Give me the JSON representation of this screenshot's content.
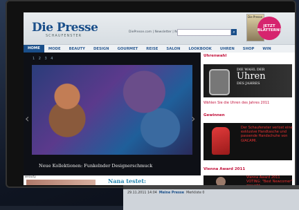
{
  "header": {
    "logo": "Die Presse",
    "tagline": "SCHAUFENSTER",
    "links": "DiePresse.com | Newsletter | Newsfeed",
    "promo_label": "Die Presse",
    "badge_text": "JETZT BLÄTTERN!"
  },
  "nav": {
    "items": [
      "HOME",
      "MODE",
      "BEAUTY",
      "DESIGN",
      "GOURMET",
      "REISE",
      "SALON",
      "LOOKBOOK",
      "UHREN",
      "SHOP",
      "WIN"
    ]
  },
  "hero": {
    "pager": "1 2 3 4",
    "caption": "Neue Kollektionen: Funkelnder Designerschmuck"
  },
  "sidebar": {
    "section1_title": "Uhrenwahl",
    "section1_headline": "DIE WAHL DER",
    "section1_big": "Uhren",
    "section1_sub": "DES JAHRES",
    "section1_link": "Wählen Sie die Uhren des Jahres 2011",
    "section2_title": "Gewinnen",
    "section2_text": "Der Schaufenster verlost eine exklusive Handtasche und passende Handschuhe von GIACAMI.",
    "section3_title": "Vienna Award 2011",
    "section3_text": "Vienna Award 2011 VOTING: \"Best Newcomer\" gesucht"
  },
  "below": {
    "category": "Beauty",
    "teaser": "Nana testet:"
  },
  "second_device": {
    "date": "29.11.2011 14:04",
    "link1": "Meine Presse",
    "link2": "Merkliste 0"
  }
}
